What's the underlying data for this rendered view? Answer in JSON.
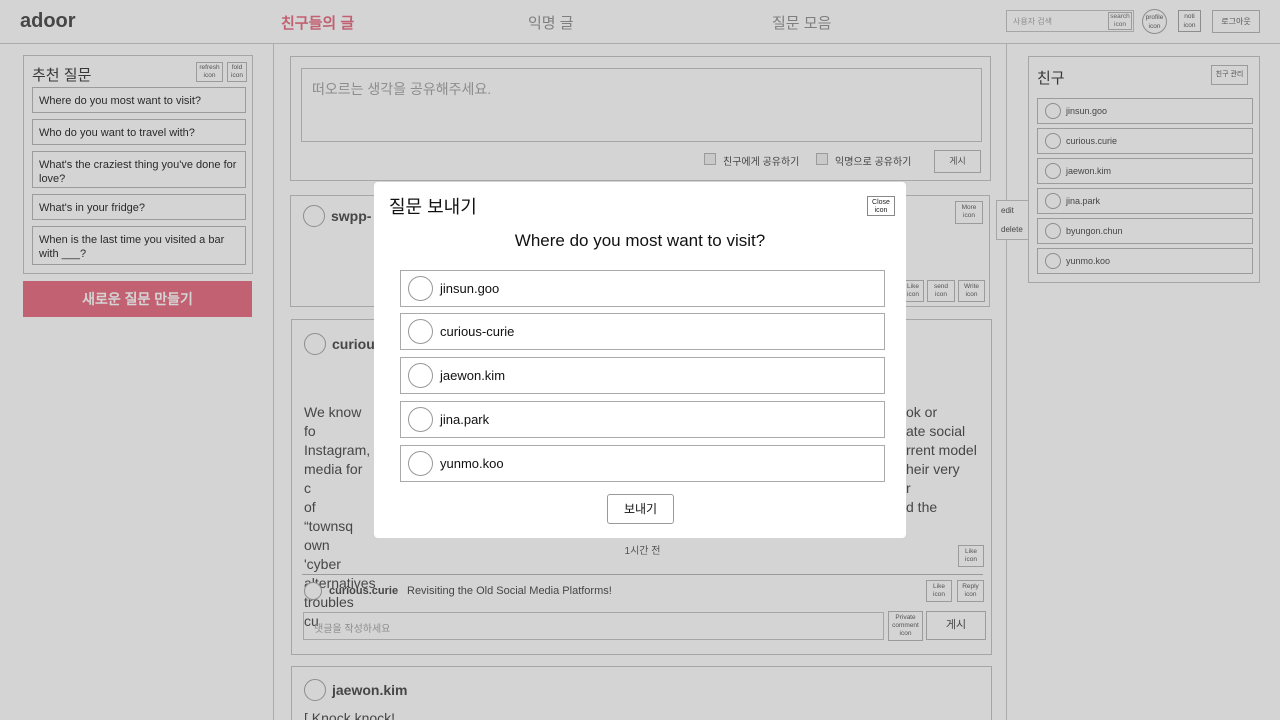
{
  "header": {
    "logo": "adoor",
    "tabs": [
      {
        "label": "친구들의 글",
        "active": true
      },
      {
        "label": "익명 글",
        "active": false
      },
      {
        "label": "질문 모음",
        "active": false
      }
    ],
    "search_placeholder": "사용자 검색",
    "search_icon_label": "search icon",
    "profile_icon_label": "profile icon",
    "noti_icon_label": "noti icon",
    "logout_label": "로그아웃"
  },
  "recommended": {
    "title": "추천 질문",
    "refresh_icon_label": "refresh icon",
    "fold_icon_label": "fold icon",
    "questions": [
      "Where do you most want to visit?",
      "Who do you want to travel with?",
      "What's the craziest thing you've done for love?",
      "What's in your fridge?",
      "When is the last time you visited a bar with ___?"
    ],
    "new_question_button": "새로운 질문 만들기"
  },
  "compose": {
    "placeholder": "떠오르는 생각을 공유해주세요.",
    "share_friends_label": "친구에게 공유하기",
    "share_anon_label": "익명으로 공유하기",
    "post_button": "게시"
  },
  "feed": {
    "post1": {
      "author": "swpp-",
      "more_icon_label": "More icon",
      "like_icon_label": "Like icon",
      "send_icon_label": "send icon",
      "write_icon_label": "Write icon",
      "menu_edit": "edit",
      "menu_delete": "delete"
    },
    "post2": {
      "author": "curiou",
      "body_lines": [
        {
          "left": "We know fo",
          "right": "ok or"
        },
        {
          "left": "Instagram,",
          "right": "ate social"
        },
        {
          "left": "media for c",
          "right": "rrent model"
        },
        {
          "left": "of “townsq",
          "right": "heir very"
        },
        {
          "left": "own 'cyber",
          "right": "r"
        },
        {
          "left": "alternatives",
          "right": "d the"
        },
        {
          "left": "troubles cu",
          "right": ""
        }
      ],
      "time": "1시간 전",
      "like_icon_label": "Like icon",
      "comment": {
        "author": "curious.curie",
        "text": "Revisiting the Old Social Media Platforms!",
        "like_icon_label": "Like icon",
        "reply_icon_label": "Reply icon"
      },
      "comment_placeholder": "댓글을 작성하세요",
      "private_comment_icon_label": "Private comment icon",
      "comment_post_button": "게시"
    },
    "post3": {
      "author": "jaewon.kim",
      "body_first_line": "[ Knock knock! "
    }
  },
  "friends": {
    "title": "친구",
    "manage_button": "친구 관리",
    "list": [
      "jinsun.goo",
      "curious.curie",
      "jaewon.kim",
      "jina.park",
      "byungon.chun",
      "yunmo.koo"
    ]
  },
  "modal": {
    "title": "질문 보내기",
    "close_icon_label": "Close icon",
    "question": "Where do you most want to visit?",
    "friends": [
      "jinsun.goo",
      "curious-curie",
      "jaewon.kim",
      "jina.park",
      "yunmo.koo"
    ],
    "send_button": "보내기"
  }
}
